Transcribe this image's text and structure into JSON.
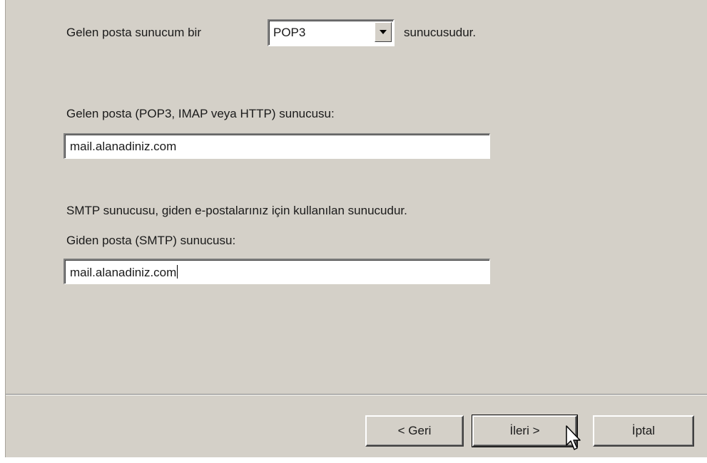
{
  "server_type": {
    "prefix": "Gelen posta sunucum bir",
    "selected": "POP3",
    "suffix": "sunucusudur."
  },
  "incoming": {
    "label": "Gelen posta (POP3, IMAP veya HTTP) sunucusu:",
    "value": "mail.alanadiniz.com"
  },
  "smtp_note": "SMTP sunucusu, giden e-postalarınız için kullanılan sunucudur.",
  "outgoing": {
    "label": "Giden posta (SMTP) sunucusu:",
    "value": "mail.alanadiniz.com"
  },
  "buttons": {
    "back": "< Geri",
    "next": "İleri >",
    "cancel": "İptal"
  }
}
